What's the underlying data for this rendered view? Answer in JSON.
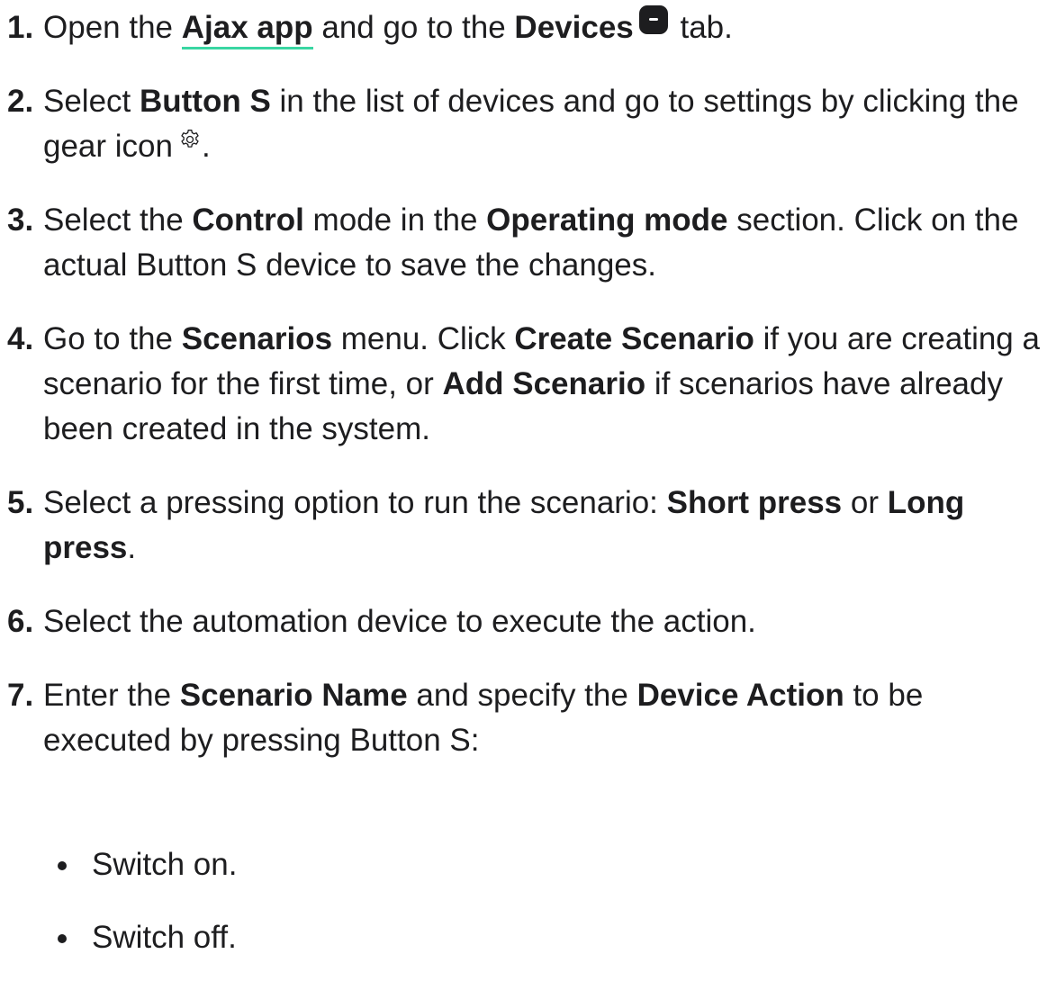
{
  "steps": [
    {
      "num": "1.",
      "t1": "Open the ",
      "link": "Ajax app",
      "t2": " and go to the ",
      "b1": "Devices",
      "t3": " tab.",
      "icon": "devices-tab-icon"
    },
    {
      "num": "2.",
      "t1": "Select ",
      "b1": "Button S",
      "t2": " in the list of devices and go to settings by clicking the gear icon",
      "t3": ".",
      "icon": "gear-icon"
    },
    {
      "num": "3.",
      "t1": "Select the ",
      "b1": "Control",
      "t2": " mode in the ",
      "b2": "Operating mode",
      "t3": " section. Click on the actual Button S device to save the changes."
    },
    {
      "num": "4.",
      "t1": "Go to the ",
      "b1": "Scenarios",
      "t2": " menu. Click ",
      "b2": "Create Scenario",
      "t3": " if you are creating a scenario for the first time, or ",
      "b3": "Add Scenario",
      "t4": " if scenarios have already been created in the system."
    },
    {
      "num": "5.",
      "t1": "Select a pressing option to run the scenario: ",
      "b1": "Short press",
      "t2": " or ",
      "b2": "Long press",
      "t3": "."
    },
    {
      "num": "6.",
      "t1": "Select the automation device to execute the action."
    },
    {
      "num": "7.",
      "t1": "Enter the ",
      "b1": "Scenario Name",
      "t2": " and specify the ",
      "b2": "Device Action",
      "t3": " to be executed by pressing Button S:"
    }
  ],
  "bullets": [
    "Switch on.",
    "Switch off."
  ],
  "colors": {
    "text": "#1d1d1f",
    "link_underline": "#39d6a2"
  }
}
